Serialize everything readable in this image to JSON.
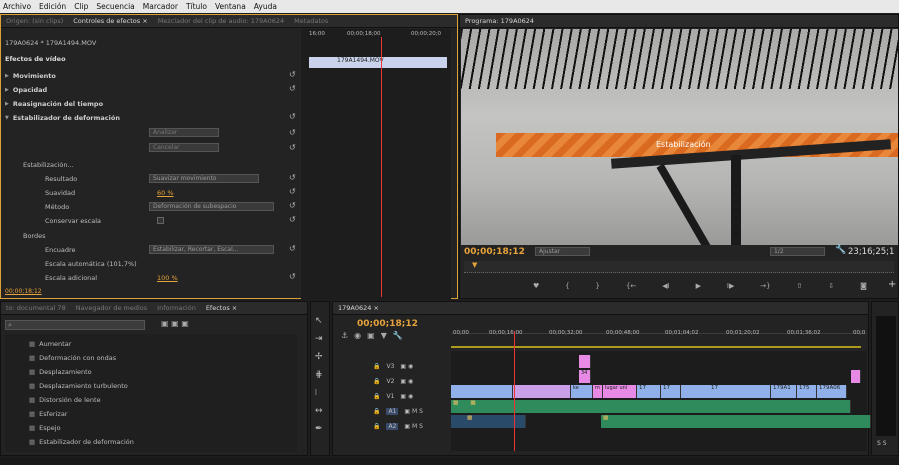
{
  "menu": [
    "Archivo",
    "Edición",
    "Clip",
    "Secuencia",
    "Marcador",
    "Título",
    "Ventana",
    "Ayuda"
  ],
  "source_panel": {
    "tabs": [
      "Origen: (sin clips)",
      "Controles de efectos ×",
      "Mezclador del clip de audio: 179A0624",
      "Metadatos"
    ]
  },
  "effect_controls": {
    "clip_path": "179A0624 * 179A1494.MOV",
    "timecodes": [
      "16;00",
      "00;00;18;00",
      "00;00;20;0"
    ],
    "clip_label": "179A1494.MOV",
    "section": "Efectos de vídeo",
    "effects": [
      "Movimiento",
      "Opacidad",
      "Reasignación del tiempo",
      "Estabilizador de deformación"
    ],
    "analyze": "Analizar",
    "cancel": "Cancelar",
    "stabilization": "Estabilización...",
    "result_label": "Resultado",
    "result_value": "Suavizar movimiento",
    "smooth_label": "Suavidad",
    "smooth_value": "60 %",
    "method_label": "Método",
    "method_value": "Deformación de subespacio",
    "keep_scale": "Conservar escala",
    "borders": "Bordes",
    "framing_label": "Encuadre",
    "framing_value": "Estabilizar, Recortar, Escal...",
    "auto_scale": "Escala automática (101,7%)",
    "extra_scale_label": "Escala adicional",
    "extra_scale_value": "100 %",
    "footer_time": "00;00;18;12"
  },
  "program": {
    "title": "Programa: 179A0624",
    "banner": "Estabilización",
    "timecode": "00;00;18;12",
    "fit": "Ajustar",
    "quality": "1/2",
    "duration": "23;16;25;1"
  },
  "project": {
    "tabs": [
      "to: documental 78",
      "Navegador de medios",
      "Información",
      "Efectos ×"
    ],
    "items": [
      "Aumentar",
      "Deformación con ondas",
      "Desplazamiento",
      "Desplazamiento turbulento",
      "Distorsión de lente",
      "Esferizar",
      "Espejo",
      "Estabilizador de deformación"
    ]
  },
  "timeline": {
    "tab": "179A0624 ×",
    "timecode": "00;00;18;12",
    "ruler": [
      "00;00",
      "00;00;16;00",
      "00;00;32;00",
      "00;00;48;00",
      "00;01;04;02",
      "00;01;20;02",
      "00;01;36;02",
      "00;0"
    ],
    "tracks": [
      "V3",
      "V2",
      "V1",
      "A1",
      "A2"
    ],
    "clips": [
      "34",
      "lugar uni",
      "17",
      "17",
      "17",
      "179A1",
      "175",
      "179A06",
      "ke",
      "m"
    ],
    "meter": "S S"
  },
  "colors": {
    "accent": "#e6a23c",
    "v1": "#8fb0e8",
    "pink": "#e68ae6",
    "audio": "#2f8a5c",
    "playhead": "#e33"
  }
}
